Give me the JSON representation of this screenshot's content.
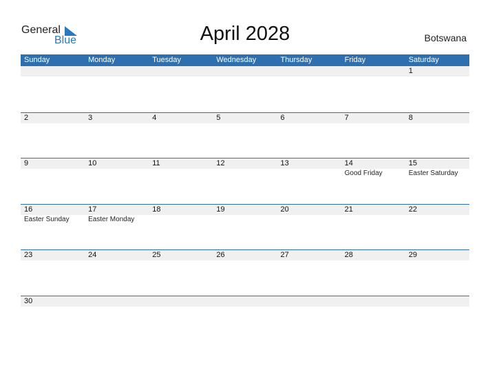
{
  "logo": {
    "word1": "General",
    "word2": "Blue"
  },
  "title": "April 2028",
  "country": "Botswana",
  "colors": {
    "header": "#2e6fb0",
    "band": "#f0f0f0",
    "brand_blue": "#2a78c2"
  },
  "weekdays": [
    "Sunday",
    "Monday",
    "Tuesday",
    "Wednesday",
    "Thursday",
    "Friday",
    "Saturday"
  ],
  "weeks": [
    [
      {
        "d": "",
        "e": ""
      },
      {
        "d": "",
        "e": ""
      },
      {
        "d": "",
        "e": ""
      },
      {
        "d": "",
        "e": ""
      },
      {
        "d": "",
        "e": ""
      },
      {
        "d": "",
        "e": ""
      },
      {
        "d": "1",
        "e": ""
      }
    ],
    [
      {
        "d": "2",
        "e": ""
      },
      {
        "d": "3",
        "e": ""
      },
      {
        "d": "4",
        "e": ""
      },
      {
        "d": "5",
        "e": ""
      },
      {
        "d": "6",
        "e": ""
      },
      {
        "d": "7",
        "e": ""
      },
      {
        "d": "8",
        "e": ""
      }
    ],
    [
      {
        "d": "9",
        "e": ""
      },
      {
        "d": "10",
        "e": ""
      },
      {
        "d": "11",
        "e": ""
      },
      {
        "d": "12",
        "e": ""
      },
      {
        "d": "13",
        "e": ""
      },
      {
        "d": "14",
        "e": "Good Friday"
      },
      {
        "d": "15",
        "e": "Easter Saturday"
      }
    ],
    [
      {
        "d": "16",
        "e": "Easter Sunday"
      },
      {
        "d": "17",
        "e": "Easter Monday"
      },
      {
        "d": "18",
        "e": ""
      },
      {
        "d": "19",
        "e": ""
      },
      {
        "d": "20",
        "e": ""
      },
      {
        "d": "21",
        "e": ""
      },
      {
        "d": "22",
        "e": ""
      }
    ],
    [
      {
        "d": "23",
        "e": ""
      },
      {
        "d": "24",
        "e": ""
      },
      {
        "d": "25",
        "e": ""
      },
      {
        "d": "26",
        "e": ""
      },
      {
        "d": "27",
        "e": ""
      },
      {
        "d": "28",
        "e": ""
      },
      {
        "d": "29",
        "e": ""
      }
    ],
    [
      {
        "d": "30",
        "e": ""
      },
      {
        "d": "",
        "e": ""
      },
      {
        "d": "",
        "e": ""
      },
      {
        "d": "",
        "e": ""
      },
      {
        "d": "",
        "e": ""
      },
      {
        "d": "",
        "e": ""
      },
      {
        "d": "",
        "e": ""
      }
    ]
  ]
}
